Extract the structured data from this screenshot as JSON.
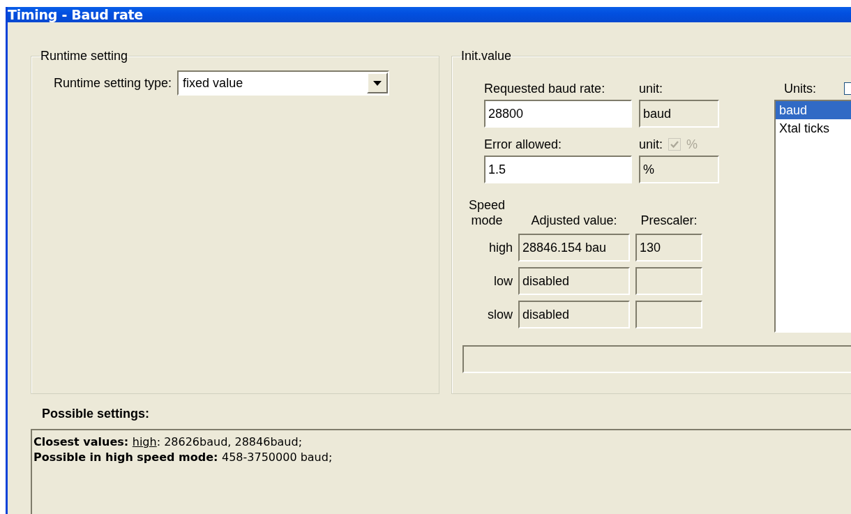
{
  "window": {
    "title": "Timing - Baud rate"
  },
  "runtime_setting": {
    "title": "Runtime setting",
    "type_label": "Runtime setting type:",
    "type_value": "fixed value"
  },
  "init_value": {
    "title": "Init.value",
    "requested": {
      "label": "Requested baud rate:",
      "value": "28800",
      "unit_label": "unit:",
      "unit_value": "baud"
    },
    "error": {
      "label": "Error allowed:",
      "value": "1.5",
      "unit_label": "unit:",
      "unit_checkbox": {
        "checked": true,
        "disabled": true,
        "label": "%"
      },
      "unit_value": "%"
    },
    "speed_header": "Speed mode",
    "adjusted_header": "Adjusted value:",
    "prescaler_header": "Prescaler:",
    "speed_rows": [
      {
        "mode": "high",
        "adjusted": "28846.154 bau",
        "prescaler": "130"
      },
      {
        "mode": "low",
        "adjusted": "disabled"
      },
      {
        "mode": "slow",
        "adjusted": "disabled"
      }
    ],
    "units": {
      "label": "Units:",
      "checkbox": {
        "checked": false
      },
      "items": [
        {
          "label": "baud",
          "selected": true
        },
        {
          "label": "Xtal ticks",
          "selected": false
        }
      ]
    }
  },
  "possible_settings": {
    "title": "Possible settings:",
    "lines": [
      {
        "segments": [
          {
            "kind": "bold",
            "text": "Closest values: "
          },
          {
            "kind": "link",
            "text": "high"
          },
          {
            "kind": "plain",
            "text": ": 28626baud, 28846baud;"
          }
        ]
      },
      {
        "segments": [
          {
            "kind": "bold",
            "text": "Possible in high speed mode: "
          },
          {
            "kind": "plain",
            "text": "458-3750000 baud;"
          }
        ]
      }
    ]
  }
}
